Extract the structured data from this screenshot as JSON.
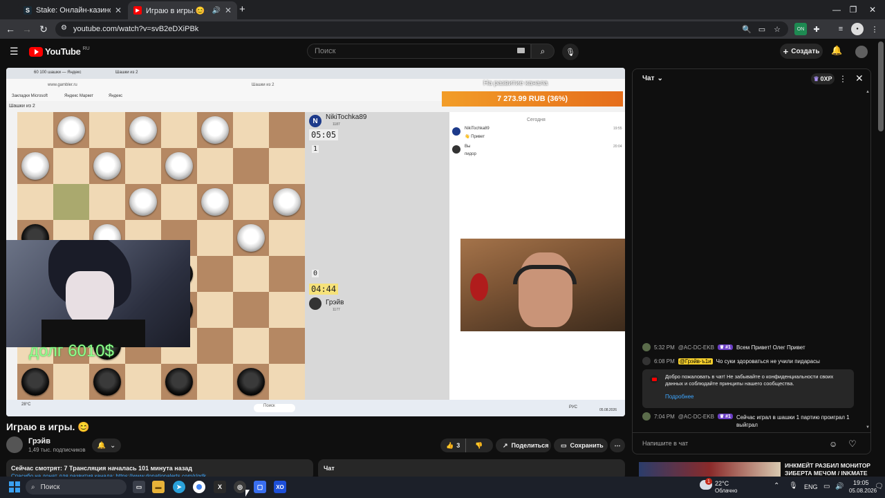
{
  "browser": {
    "tabs": [
      {
        "title": "Stake: Онлайн-казино и ставк",
        "active": false
      },
      {
        "title": "Играю в игры.😊 - YouTub",
        "active": true
      }
    ],
    "new_tab": "+",
    "url": "youtube.com/watch?v=svB2eDXiPBk",
    "window_controls": [
      "—",
      "❐",
      "✕"
    ]
  },
  "youtube": {
    "logo_text": "YouTube",
    "logo_region": "RU",
    "search_placeholder": "Поиск",
    "create_label": "Создать"
  },
  "video": {
    "inner_browser": {
      "tab_label": "60 100 шашки — Яндекс",
      "tab2_label": "Шашки из 2",
      "address": "www.gambler.ru",
      "page_title": "Шашки из 2",
      "bookmarks": [
        "Закладки Microsoft",
        "Яндекс Маркет",
        "Яндекс"
      ],
      "back_label": "Шашки из 2"
    },
    "overlay_amount": "7 273.99 RUB (36%)",
    "overlay_caption": "На развитие канала",
    "opponent": {
      "name": "NikiTochka89",
      "rating": "1187",
      "timer": "05:05",
      "score": "1",
      "avatar_letter": "N"
    },
    "player": {
      "name": "Грэйв",
      "rating": "1177",
      "timer": "04:44",
      "score": "0"
    },
    "inner_chat": {
      "date_label": "Сегодня",
      "messages": [
        {
          "user": "NikiTochka89",
          "text": "👋 Привет",
          "time": "19:55"
        },
        {
          "user": "Вы",
          "text": "пидор",
          "time": "20:04"
        }
      ]
    },
    "debt_text": "долг 6010$",
    "inner_taskbar": {
      "search": "Поиск",
      "weather": "28°C",
      "lang": "РУС",
      "date": "05.08.2026"
    }
  },
  "below": {
    "title": "Играю в игры. 😊",
    "channel_name": "Грэйв",
    "subscribers": "1,49 тыс. подписчиков",
    "likes": "3",
    "share_label": "Поделиться",
    "save_label": "Сохранить",
    "watching": "Сейчас смотрят: 7  Трансляция началась 101 минута назад",
    "desc_link": "Спасибо на донат для развития канала: https://www.donationalerts.com/r/gdk",
    "chat_tab": "Чат"
  },
  "chat": {
    "title": "Чат",
    "xp": "0XP",
    "messages": [
      {
        "time": "5:32 PM",
        "user": "@AC-DC-EKB",
        "badge": "#1",
        "text": "Всем Привет! Олег Привет"
      },
      {
        "time": "6:08 PM",
        "user": "@Грэйв-ъ1и",
        "badge": "",
        "text": "Чо суки здороваться не учили пидарасы"
      },
      {
        "time": "7:04 PM",
        "user": "@AC-DC-EKB",
        "badge": "#1",
        "text": "Сейчас играл в шашки 1 партию проиграл 1 выйграл"
      }
    ],
    "welcome_text": "Добро пожаловать в чат! Не забывайте о конфиденциальности своих данных и соблюдайте принципы нашего сообщества.",
    "welcome_link": "Подробнее",
    "input_placeholder": "Напишите в чат"
  },
  "recommended": {
    "title": "ИНКМЕЙТ РАЗБИЛ МОНИТОР ЗИБЕРТА МЕЧОМ / INKMATE"
  },
  "taskbar": {
    "search": "Поиск",
    "weather_temp": "22°C",
    "weather_text": "Облачно",
    "lang": "ENG",
    "time": "19:05",
    "date": "05.08.2026",
    "notif_count": "1"
  },
  "colors": {
    "youtube_red": "#ff0000",
    "accent_orange": "#e56d1b",
    "link_blue": "#3ea6ff"
  }
}
